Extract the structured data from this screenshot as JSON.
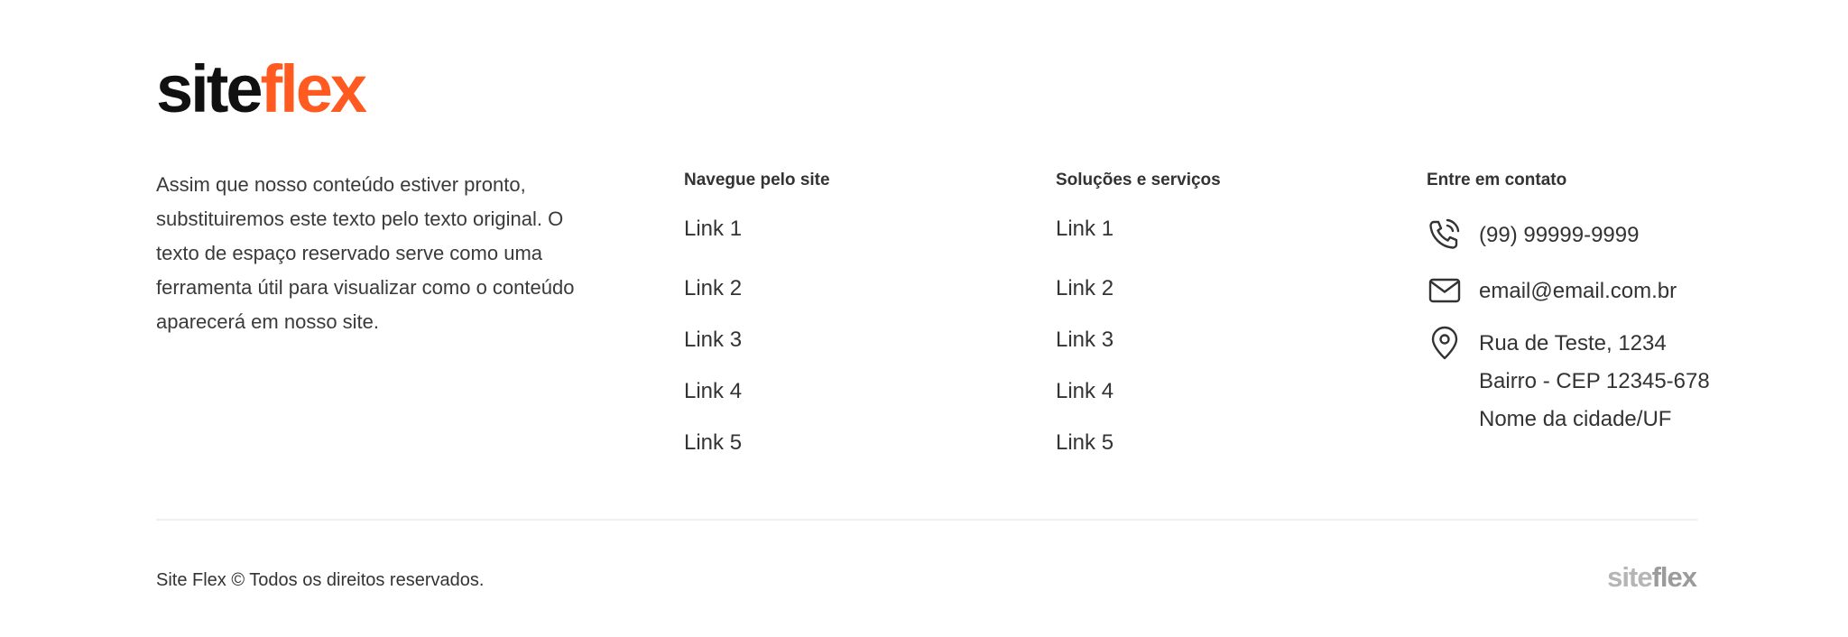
{
  "brand": {
    "part1": "site",
    "part2": "flex"
  },
  "about": {
    "text": "Assim que nosso conteúdo estiver pronto, substituiremos este texto pelo texto original. O texto de espaço reservado serve como uma ferramenta útil para visualizar como o conteúdo aparecerá em nosso site."
  },
  "nav": {
    "title": "Navegue pelo site",
    "links": [
      "Link 1",
      "Link 2",
      "Link 3",
      "Link 4",
      "Link 5"
    ]
  },
  "services": {
    "title": "Soluções e serviços",
    "links": [
      "Link 1",
      "Link 2",
      "Link 3",
      "Link 4",
      "Link 5"
    ]
  },
  "contact": {
    "title": "Entre em contato",
    "phone": "(99) 99999-9999",
    "email": "email@email.com.br",
    "address_line1": "Rua de Teste, 1234",
    "address_line2": "Bairro - CEP 12345-678",
    "address_line3": "Nome da cidade/UF",
    "icons": [
      "phone-icon",
      "mail-icon",
      "location-pin-icon"
    ]
  },
  "bottom": {
    "copyright": "Site Flex © Todos os direitos reservados."
  },
  "colors": {
    "accent": "#ff5a1f",
    "text": "#333333",
    "logo_dark": "#111111",
    "muted_logo": "#b5b5b5"
  }
}
